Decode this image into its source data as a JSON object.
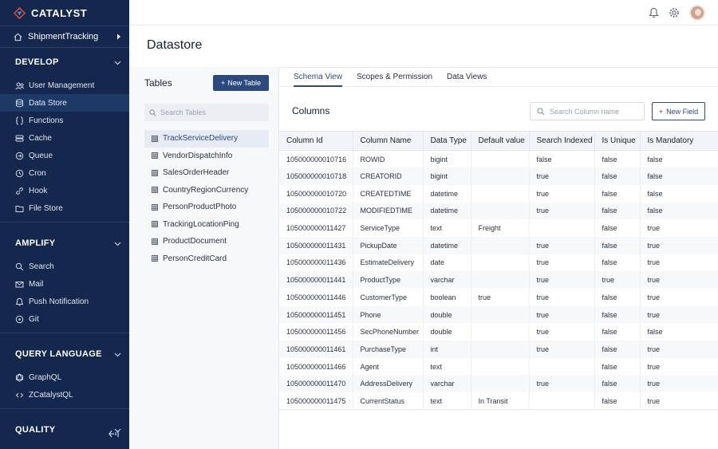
{
  "brand": {
    "name": "CATALYST"
  },
  "project": {
    "name": "ShipmentTracking"
  },
  "sidebar": {
    "sections": [
      {
        "title": "DEVELOP",
        "items": [
          {
            "label": "User Management",
            "icon": "users-icon"
          },
          {
            "label": "Data Store",
            "icon": "database-icon"
          },
          {
            "label": "Functions",
            "icon": "braces-icon"
          },
          {
            "label": "Cache",
            "icon": "cache-icon"
          },
          {
            "label": "Queue",
            "icon": "queue-icon"
          },
          {
            "label": "Cron",
            "icon": "clock-icon"
          },
          {
            "label": "Hook",
            "icon": "link-icon"
          },
          {
            "label": "File Store",
            "icon": "folder-icon"
          }
        ]
      },
      {
        "title": "AMPLIFY",
        "items": [
          {
            "label": "Search",
            "icon": "search-icon"
          },
          {
            "label": "Mail",
            "icon": "mail-icon"
          },
          {
            "label": "Push Notification",
            "icon": "bell-icon"
          },
          {
            "label": "Git",
            "icon": "git-icon"
          }
        ]
      },
      {
        "title": "QUERY LANGUAGE",
        "items": [
          {
            "label": "GraphQL",
            "icon": "graphql-icon"
          },
          {
            "label": "ZCatalystQL",
            "icon": "sql-icon"
          }
        ]
      },
      {
        "title": "QUALITY",
        "items": []
      }
    ]
  },
  "page": {
    "title": "Datastore"
  },
  "tables_panel": {
    "title": "Tables",
    "new_table_label": "New Table",
    "search_placeholder": "Search Tables",
    "items": [
      "TrackServiceDelivery",
      "VendorDispatchInfo",
      "SalesOrderHeader",
      "CountryRegionCurrency",
      "PersonProductPhoto",
      "TrackingLocationPing",
      "ProductDocument",
      "PersonCreditCard"
    ]
  },
  "tabs": [
    "Schema View",
    "Scopes & Permission",
    "Data Views"
  ],
  "columns_panel": {
    "title": "Columns",
    "search_placeholder": "Search Column name",
    "new_field_label": "New Field",
    "headers": [
      "Column Id",
      "Column Name",
      "Data Type",
      "Default value",
      "Search Indexed",
      "Is Unique",
      "Is Mandatory"
    ],
    "rows": [
      [
        "105000000010716",
        "ROWID",
        "bigint",
        "",
        "false",
        "false",
        "false"
      ],
      [
        "105000000010718",
        "CREATORID",
        "bigint",
        "",
        "true",
        "false",
        "false"
      ],
      [
        "105000000010720",
        "CREATEDTIME",
        "datetime",
        "",
        "true",
        "false",
        "false"
      ],
      [
        "105000000010722",
        "MODIFIEDTIME",
        "datetime",
        "",
        "true",
        "false",
        "false"
      ],
      [
        "105000000011427",
        "ServiceType",
        "text",
        "Freight",
        "",
        "false",
        "true"
      ],
      [
        "105000000011431",
        "PickupDate",
        "datetime",
        "",
        "true",
        "false",
        "true"
      ],
      [
        "105000000011436",
        "EstimateDelivery",
        "date",
        "",
        "true",
        "false",
        "true"
      ],
      [
        "105000000011441",
        "ProductType",
        "varchar",
        "",
        "true",
        "true",
        "true"
      ],
      [
        "105000000011446",
        "CustomerType",
        "boolean",
        "true",
        "true",
        "false",
        "true"
      ],
      [
        "105000000011451",
        "Phone",
        "double",
        "",
        "true",
        "false",
        "true"
      ],
      [
        "105000000011456",
        "SecPhoneNumber",
        "double",
        "",
        "true",
        "false",
        "false"
      ],
      [
        "105000000011461",
        "PurchaseType",
        "int",
        "",
        "true",
        "false",
        "true"
      ],
      [
        "105000000011466",
        "Agent",
        "text",
        "",
        "",
        "false",
        "true"
      ],
      [
        "105000000011470",
        "AddressDelivery",
        "varchar",
        "",
        "true",
        "false",
        "true"
      ],
      [
        "105000000011475",
        "CurrentStatus",
        "text",
        "In Transit",
        "",
        "false",
        "true"
      ]
    ]
  },
  "colors": {
    "sidebar_bg": "#13284c",
    "accent": "#2c4a7e",
    "active_item_bg": "#1d3a66"
  }
}
